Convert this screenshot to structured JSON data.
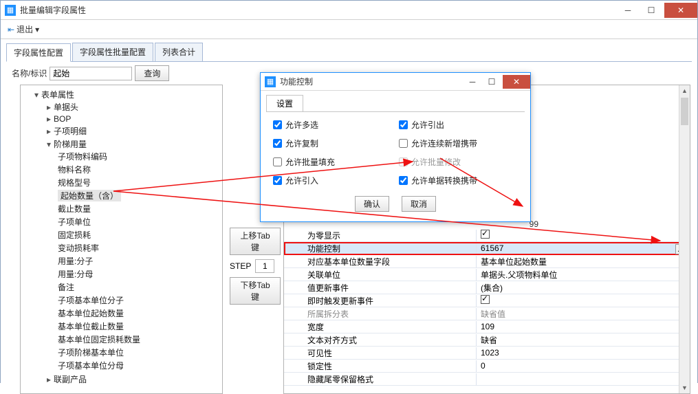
{
  "window": {
    "title": "批量编辑字段属性"
  },
  "toolbar": {
    "exit": "退出"
  },
  "tabs": [
    {
      "label": "字段属性配置",
      "active": true
    },
    {
      "label": "字段属性批量配置",
      "active": false
    },
    {
      "label": "列表合计",
      "active": false
    }
  ],
  "search": {
    "label": "名称/标识",
    "value": "起始",
    "button": "查询"
  },
  "tree": {
    "root": "表单属性",
    "groups": [
      {
        "label": "单据头"
      },
      {
        "label": "BOP"
      },
      {
        "label": "子项明细"
      },
      {
        "label": "阶梯用量",
        "expanded": true,
        "children": [
          "子项物料编码",
          "物料名称",
          "规格型号",
          "起始数量（含）",
          "截止数量",
          "子项单位",
          "固定损耗",
          "变动损耗率",
          "用量:分子",
          "用量:分母",
          "备注",
          "子项基本单位分子",
          "基本单位起始数量",
          "基本单位截止数量",
          "基本单位固定损耗数量",
          "子项阶梯基本单位",
          "子项基本单位分母"
        ]
      },
      {
        "label": "联副产品"
      }
    ],
    "selected": "起始数量（含）"
  },
  "midButtons": {
    "moveUp": "上移Tab键",
    "stepLabel": "STEP",
    "stepValue": "1",
    "moveDown": "下移Tab键"
  },
  "propGrid": {
    "partial_top": "99",
    "rows": [
      {
        "name": "为零显示",
        "type": "check",
        "checked": true
      },
      {
        "name": "功能控制",
        "value": "61567",
        "highlight": true,
        "ell": true,
        "selected": true
      },
      {
        "name": "对应基本单位数量字段",
        "value": "基本单位起始数量"
      },
      {
        "name": "关联单位",
        "value": "单据头.父项物料单位"
      },
      {
        "name": "值更新事件",
        "value": "(集合)"
      },
      {
        "name": "即时触发更新事件",
        "type": "check",
        "checked": true
      },
      {
        "name": "所属拆分表",
        "value": "缺省值",
        "grey": true
      },
      {
        "name": "宽度",
        "value": "109"
      },
      {
        "name": "文本对齐方式",
        "value": "缺省"
      },
      {
        "name": "可见性",
        "value": "1023"
      },
      {
        "name": "锁定性",
        "value": "0"
      },
      {
        "name": "隐藏尾零保留格式",
        "value": ""
      }
    ]
  },
  "dialog": {
    "title": "功能控制",
    "tab": "设置",
    "options": [
      {
        "label": "允许多选",
        "checked": true
      },
      {
        "label": "允许引出",
        "checked": true
      },
      {
        "label": "允许复制",
        "checked": true
      },
      {
        "label": "允许连续新增携带",
        "checked": false
      },
      {
        "label": "允许批量填充",
        "checked": false
      },
      {
        "label": "允许批量修改",
        "checked": false,
        "disabled": true
      },
      {
        "label": "允许引入",
        "checked": true
      },
      {
        "label": "允许单据转换携带",
        "checked": true
      }
    ],
    "ok": "确认",
    "cancel": "取消"
  }
}
